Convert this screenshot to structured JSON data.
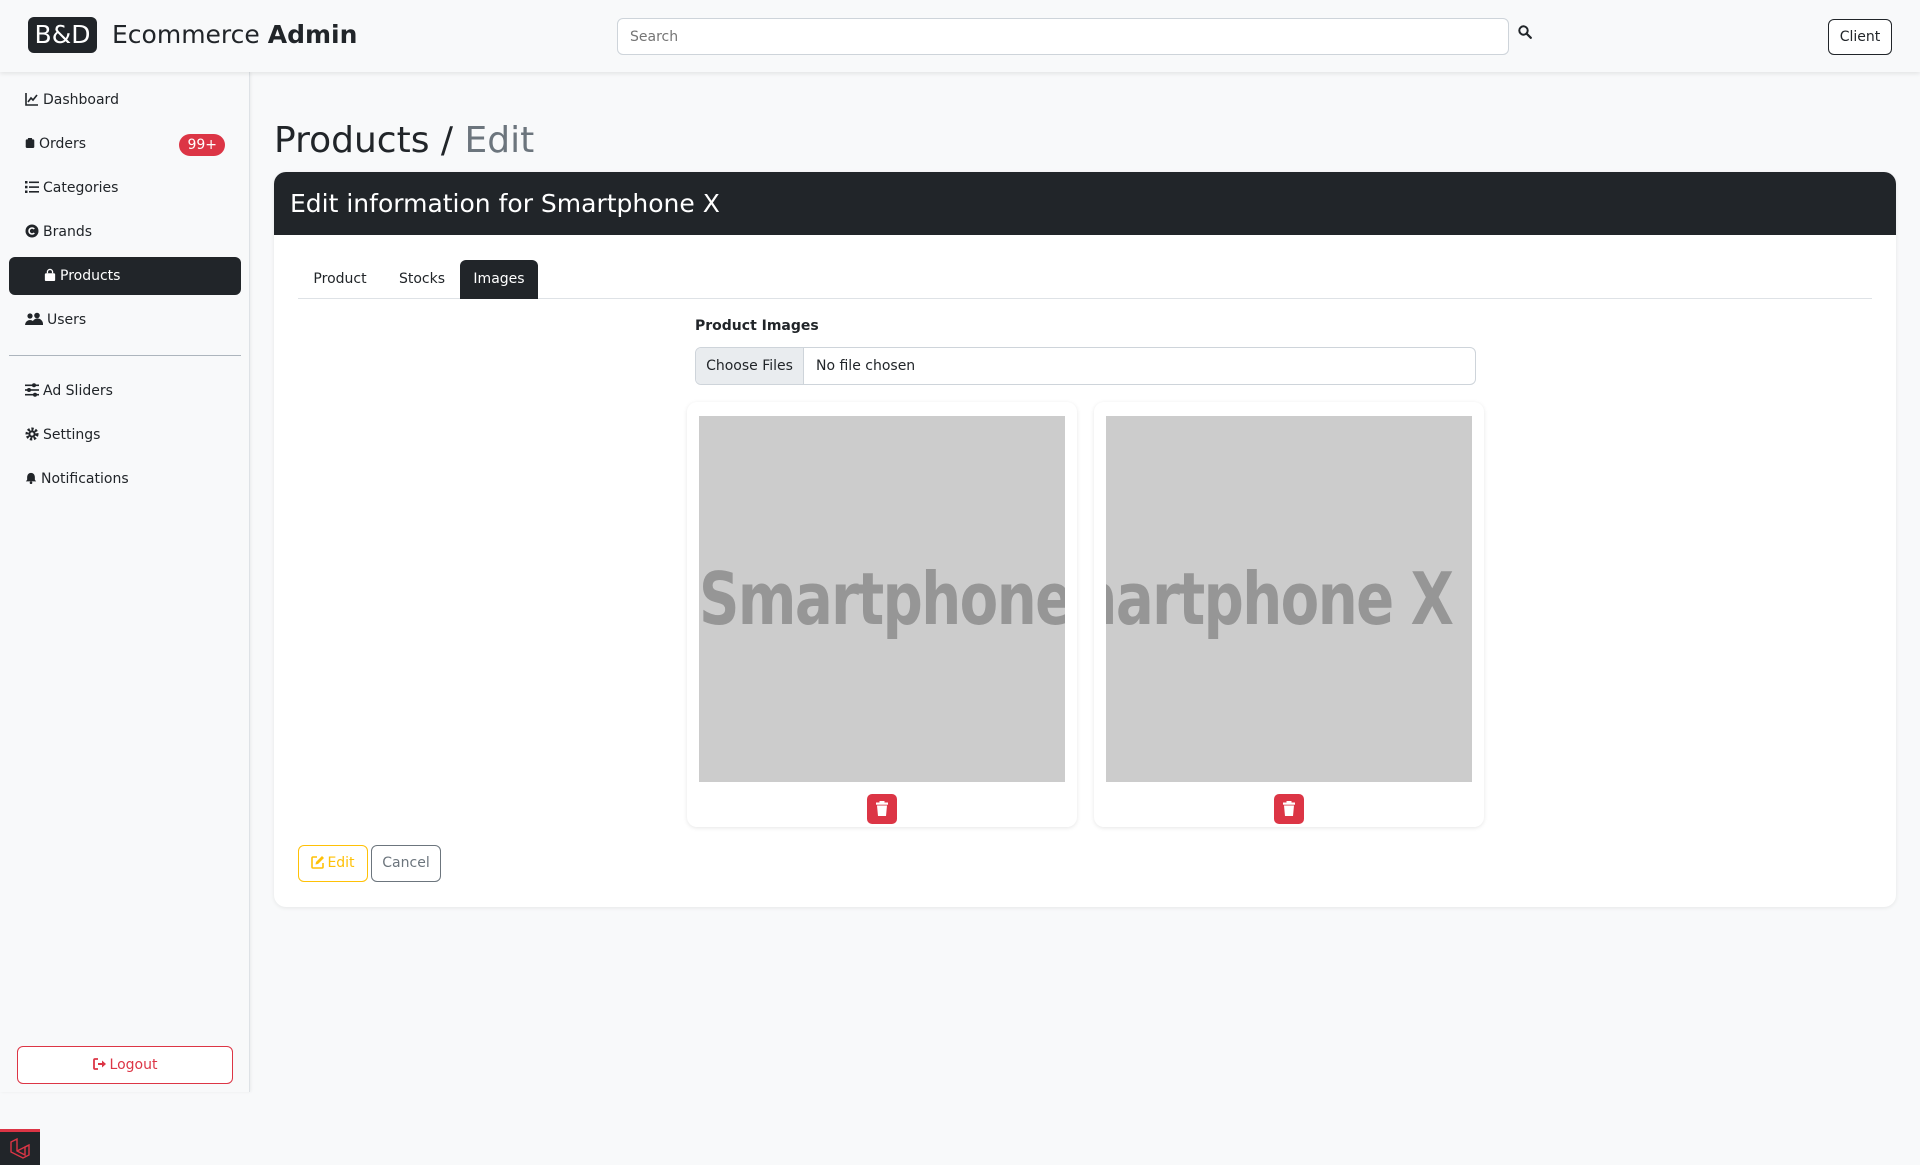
{
  "topbar": {
    "logo_text": "B&D",
    "title_prefix": "Ecommerce",
    "title_bold": "Admin",
    "search_placeholder": "Search",
    "client_label": "Client"
  },
  "sidebar": {
    "items": [
      {
        "label": "Dashboard",
        "icon": "chart-line-icon"
      },
      {
        "label": "Orders",
        "icon": "clipboard-icon",
        "badge": "99+"
      },
      {
        "label": "Categories",
        "icon": "list-icon"
      },
      {
        "label": "Brands",
        "icon": "copyright-icon"
      },
      {
        "label": "Products",
        "icon": "shopping-bag-icon",
        "active": true
      },
      {
        "label": "Users",
        "icon": "users-icon"
      },
      {
        "label": "Ad Sliders",
        "icon": "sliders-icon"
      },
      {
        "label": "Settings",
        "icon": "gear-icon"
      },
      {
        "label": "Notifications",
        "icon": "bell-icon"
      }
    ],
    "logout_label": "Logout"
  },
  "page": {
    "title": "Products /",
    "title_muted": "Edit",
    "card_header": "Edit information for Smartphone X",
    "tabs": [
      "Product",
      "Stocks",
      "Images"
    ],
    "active_tab": "Images",
    "field_label": "Product Images",
    "file_button": "Choose Files",
    "file_status": "No file chosen",
    "images": [
      {
        "text": "Smartphone X"
      },
      {
        "text": "Smartphone X De"
      }
    ],
    "edit_label": "Edit",
    "cancel_label": "Cancel"
  },
  "colors": {
    "dark": "#212529",
    "danger": "#dc3545",
    "warning": "#ffc107",
    "secondary": "#6c757d",
    "placeholder_bg": "#cccccc"
  }
}
